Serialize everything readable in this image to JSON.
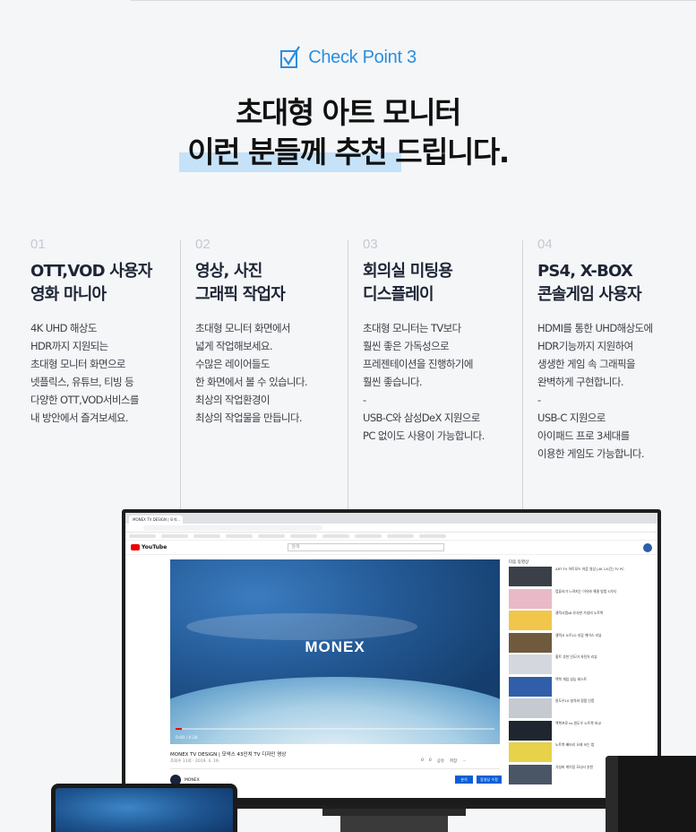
{
  "check_point": {
    "label": "Check Point 3"
  },
  "headline": {
    "line1": "초대형 아트 모니터",
    "line2": "이런 분들께 추천 드립니다."
  },
  "columns": [
    {
      "number": "01",
      "title": "OTT,VOD 사용자\n영화 마니아",
      "body": "4K UHD 해상도\nHDR까지 지원되는\n초대형 모니터 화면으로\n넷플릭스, 유튜브, 티빙 등\n다양한 OTT,VOD서비스를\n내 방안에서 즐겨보세요."
    },
    {
      "number": "02",
      "title": "영상, 사진\n그래픽 작업자",
      "body": "초대형 모니터 화면에서\n넓게 작업해보세요.\n수많은 레이어들도\n한 화면에서 볼 수 있습니다.\n최상의 작업환경이\n최상의 작업물을 만듭니다."
    },
    {
      "number": "03",
      "title": "회의실 미팅용\n디스플레이",
      "body": "초대형 모니터는 TV보다\n훨씬 좋은 가독성으로\n프레젠테이션을 진행하기에\n훨씬 좋습니다.\n-\nUSB-C와 삼성DeX 지원으로\nPC 없이도 사용이 가능합니다."
    },
    {
      "number": "04",
      "title": "PS4, X-BOX\n콘솔게임 사용자",
      "body": "HDMI를 통한 UHD해상도에\nHDR기능까지 지원하여\n생생한 게임 속 그래픽을\n완벽하게 구현합니다.\n-\nUSB-C 지원으로\n아이패드 프로 3세대를\n이용한 게임도 가능합니다."
    }
  ],
  "monitor": {
    "tab_label": "MONEX TV DESIGN | 모넥...",
    "youtube_logo": "YouTube",
    "search_placeholder": "검색",
    "video_brand": "MONEX",
    "video_title": "MONEX TV DESIGN | 모넥스 43인치 TV 디자인 영상",
    "video_meta": "조회수 11회 · 2019. 4. 19.",
    "time_display": "0:00 / 0:26",
    "actions": [
      "0",
      "0",
      "공유",
      "저장",
      "..."
    ],
    "channel_name": "MONEX",
    "join_label": "분석",
    "subscribe_label": "동영상 수정",
    "sidebar_header": "다음 동영상",
    "progress_fraction": 0.02,
    "sidebar_items": [
      {
        "text": "ART TV 아트모드 저음 영상 [4K 1시간] TV PC",
        "color": "#3a3f48"
      },
      {
        "text": "컴퓨터가 느려지는 이유와 해결 방법 5가지",
        "color": "#e9b9c8"
      },
      {
        "text": "갤럭시탭s6 유사한 가성비 노트북",
        "color": "#f2c64a"
      },
      {
        "text": "갤럭시 노트10 지갑 케이스 리뷰",
        "color": "#6f5a3e"
      },
      {
        "text": "홈트 추천 인도어 자전거 리뷰",
        "color": "#d4d8de"
      },
      {
        "text": "맥북 게임 성능 테스트",
        "color": "#2f5fa8"
      },
      {
        "text": "윈도우10 설치와 정품 인증",
        "color": "#c5c9d0"
      },
      {
        "text": "맥북프로 vs 윈도우 노트북 비교",
        "color": "#1f2630"
      },
      {
        "text": "노트북 배터리 오래 쓰는 법",
        "color": "#e7d24a"
      },
      {
        "text": "가성비 게이밍 모니터 추천",
        "color": "#4a5566"
      }
    ]
  }
}
